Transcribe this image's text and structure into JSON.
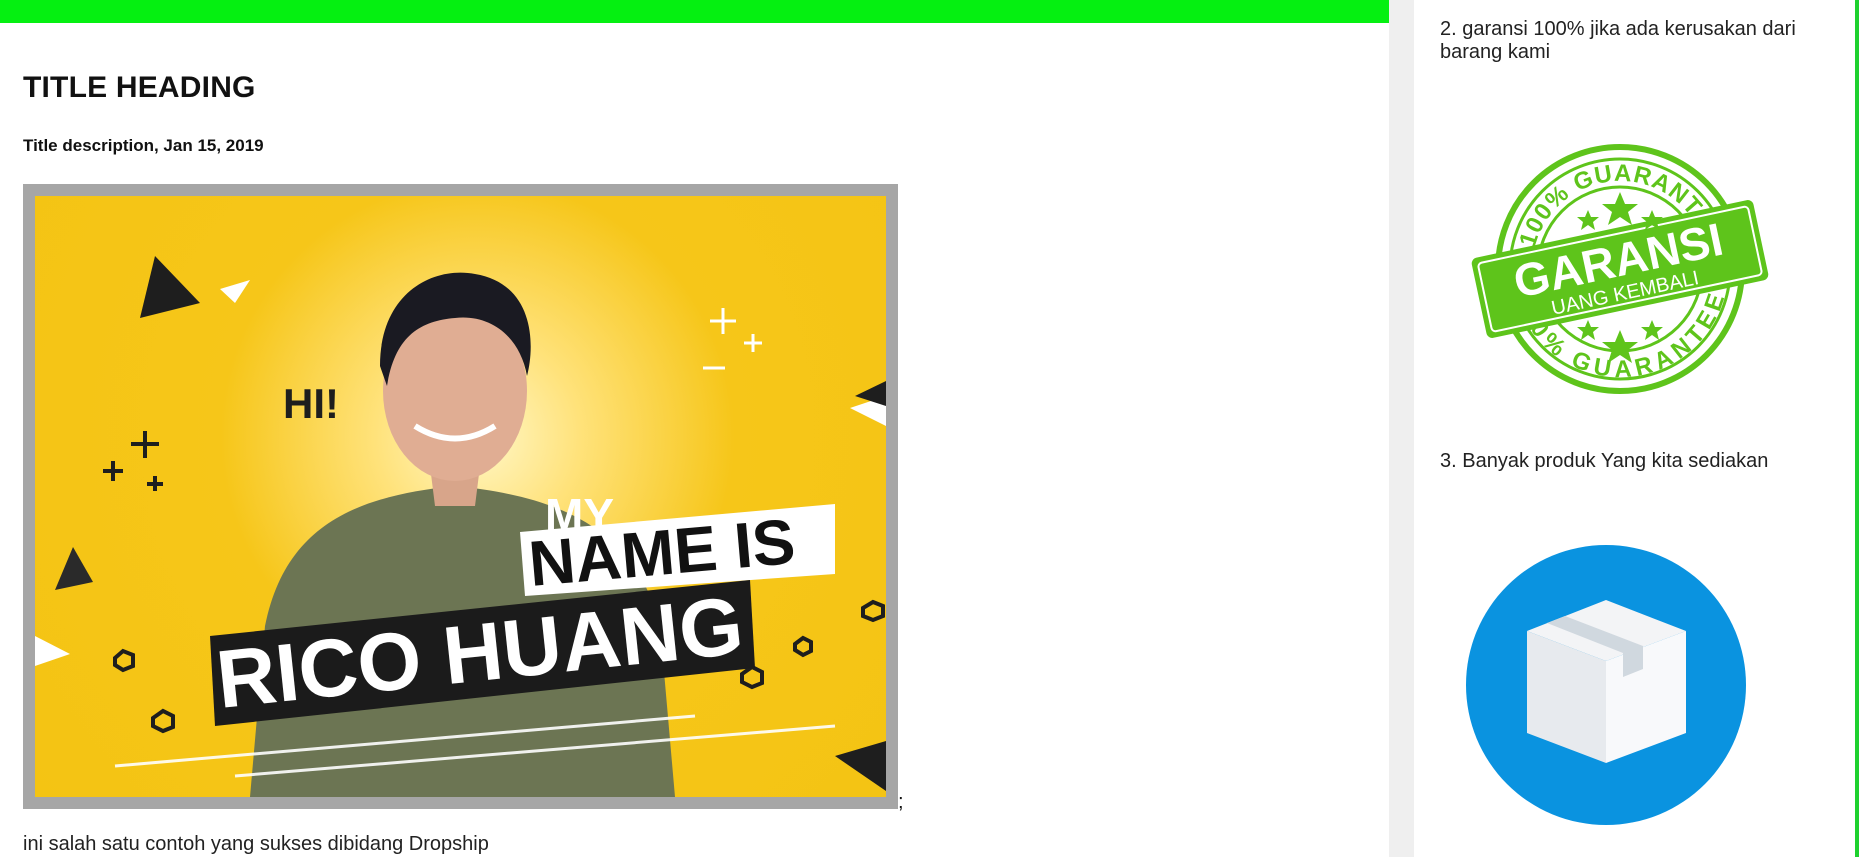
{
  "header": {
    "bar_color": "#05f011"
  },
  "post": {
    "title": "TITLE HEADING",
    "subtitle": "Title description, Jan 15, 2019",
    "image": {
      "greeting": "HI!",
      "line1": "MY",
      "line2": "NAME IS",
      "line3": "RICO HUANG",
      "background_color": "#f4c413"
    },
    "semicolon": ";",
    "caption": "ini salah satu contoh yang sukses dibidang Dropship"
  },
  "sidebar": {
    "item2": "2. garansi 100% jika ada kerusakan dari barang kami",
    "badge": {
      "top_text": "100% GUARANTEE",
      "main_text": "GARANSI",
      "sub_text": "UANG KEMBALI",
      "bottom_text": "100% GUARANTEE",
      "color": "#5ec41b"
    },
    "item3": "3. Banyak produk Yang kita sediakan",
    "box_icon": {
      "name": "box-icon",
      "color": "#0a93e0"
    }
  }
}
